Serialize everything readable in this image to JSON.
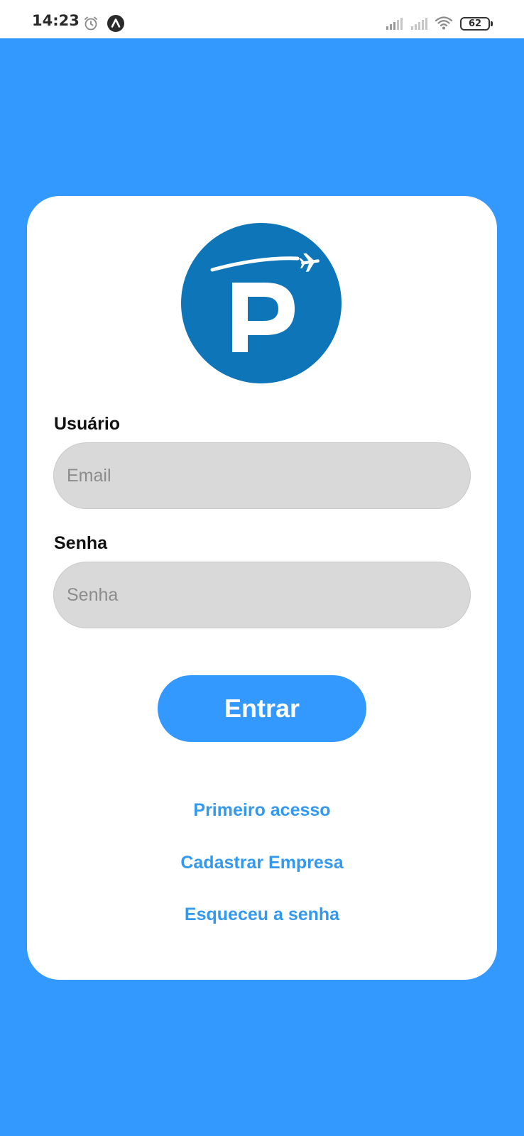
{
  "status_bar": {
    "time": "14:23",
    "battery_level": "62",
    "icons": [
      "alarm-icon",
      "app-notification-icon",
      "signal-icon",
      "signal-icon",
      "wifi-icon",
      "battery-icon"
    ]
  },
  "colors": {
    "primary": "#3399ff",
    "card": "#ffffff",
    "input_bg": "#d9d9d9",
    "logo_blue": "#0e76b8",
    "link": "#3399ee"
  },
  "login": {
    "logo_icon": "parking-plane-logo",
    "user_label": "Usuário",
    "email_placeholder": "Email",
    "email_value": "",
    "password_label": "Senha",
    "password_placeholder": "Senha",
    "password_value": "",
    "enter_button": "Entrar",
    "links": {
      "first_access": "Primeiro acesso",
      "register_company": "Cadastrar Empresa",
      "forgot_password": "Esqueceu a senha"
    }
  }
}
